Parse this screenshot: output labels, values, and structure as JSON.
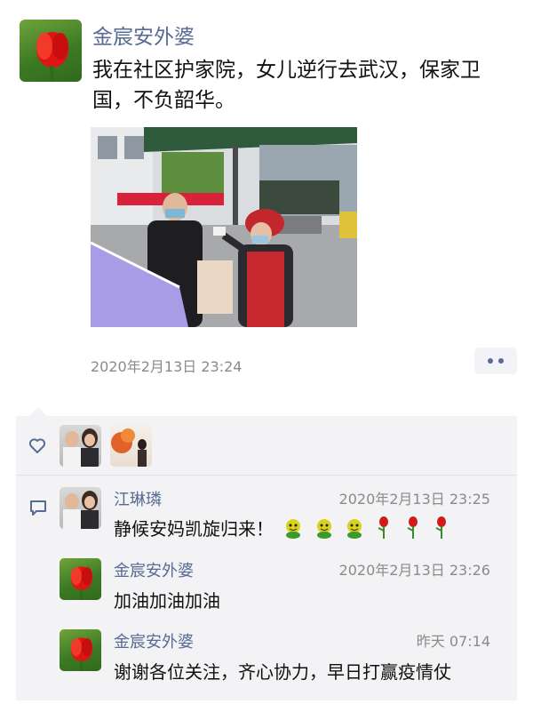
{
  "post": {
    "author": "金宸安外婆",
    "text": "我在社区护家院，女儿逆行去武汉，保家卫国，不负韶华。",
    "timestamp": "2020年2月13日 23:24"
  },
  "likes": {
    "icon": "heart-icon"
  },
  "comments": [
    {
      "name": "江琳璘",
      "time": "2020年2月13日 23:25",
      "text": "静候安妈凯旋归来！"
    },
    {
      "name": "金宸安外婆",
      "time": "2020年2月13日 23:26",
      "text": "加油加油加油"
    },
    {
      "name": "金宸安外婆",
      "time": "昨天 07:14",
      "text": "谢谢各位关注，齐心协力，早日打赢疫情仗"
    }
  ],
  "colors": {
    "link": "#576b95",
    "panel": "#f3f3f5"
  }
}
